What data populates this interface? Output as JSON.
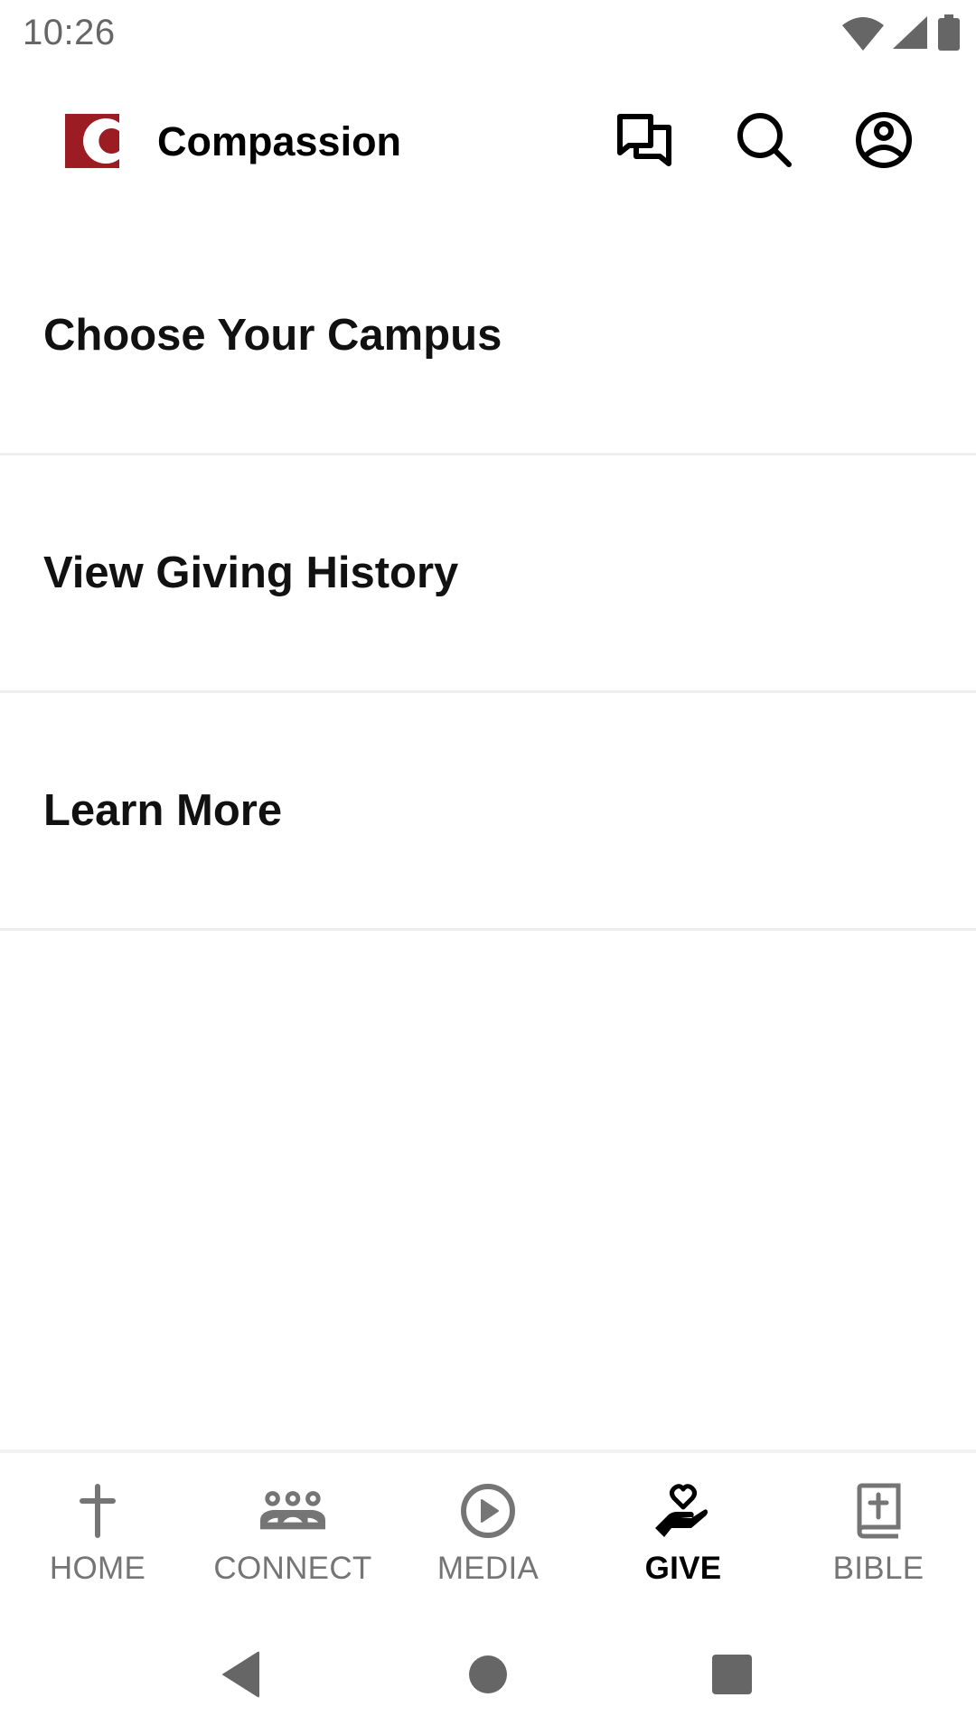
{
  "status_bar": {
    "time": "10:26",
    "icons": [
      "wifi-icon",
      "cellular-signal-icon",
      "battery-icon"
    ]
  },
  "app_bar": {
    "title": "Compassion",
    "logo": "compassion-logo",
    "brand_color": "#9b1c22",
    "actions": [
      {
        "name": "messages",
        "icon": "chat-bubbles-icon"
      },
      {
        "name": "search",
        "icon": "search-icon"
      },
      {
        "name": "profile",
        "icon": "account-circle-icon"
      }
    ]
  },
  "menu": {
    "items": [
      {
        "label": "Choose Your Campus"
      },
      {
        "label": "View Giving History"
      },
      {
        "label": "Learn More"
      }
    ]
  },
  "bottom_nav": {
    "active": "GIVE",
    "inactive_color": "#757575",
    "active_color": "#000000",
    "items": [
      {
        "label": "HOME",
        "icon": "cross-icon"
      },
      {
        "label": "CONNECT",
        "icon": "group-icon"
      },
      {
        "label": "MEDIA",
        "icon": "play-circle-icon"
      },
      {
        "label": "GIVE",
        "icon": "hand-heart-icon"
      },
      {
        "label": "BIBLE",
        "icon": "bible-icon"
      }
    ]
  },
  "system_nav": {
    "buttons": [
      "back",
      "home",
      "recents"
    ]
  }
}
